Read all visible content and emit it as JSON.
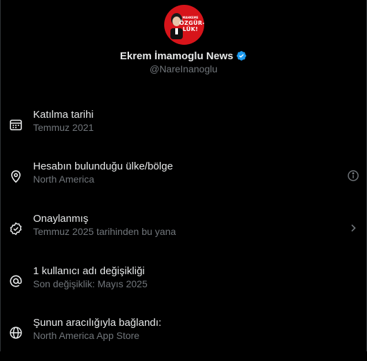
{
  "profile": {
    "avatar_text_small": "MAHKEME",
    "avatar_text_line1": "ÖZGÜR-",
    "avatar_text_line2": "LÜK!",
    "name": "Ekrem İmamoglu News",
    "handle": "@NareInanoglu",
    "verified_icon": "verified-badge-icon",
    "verified_color": "#1d9bf0"
  },
  "info_items": [
    {
      "icon": "calendar-icon",
      "title": "Katılma tarihi",
      "subtitle": "Temmuz 2021"
    },
    {
      "icon": "location-pin-icon",
      "title": "Hesabın bulunduğu ülke/bölge",
      "subtitle": "North America",
      "trailing_icon": "info-icon"
    },
    {
      "icon": "verified-check-icon",
      "title": "Onaylanmış",
      "subtitle": "Temmuz 2025 tarihinden bu yana",
      "trailing_icon": "chevron-right-icon"
    },
    {
      "icon": "at-sign-icon",
      "title": "1 kullanıcı adı değişikliği",
      "subtitle": "Son değişiklik: Mayıs 2025"
    },
    {
      "icon": "globe-icon",
      "title": "Şunun aracılığıyla bağlandı:",
      "subtitle": "North America App Store"
    }
  ],
  "colors": {
    "background": "#000000",
    "primary_text": "#e7e9ea",
    "secondary_text": "#71767b",
    "avatar_red": "#d7141a"
  }
}
